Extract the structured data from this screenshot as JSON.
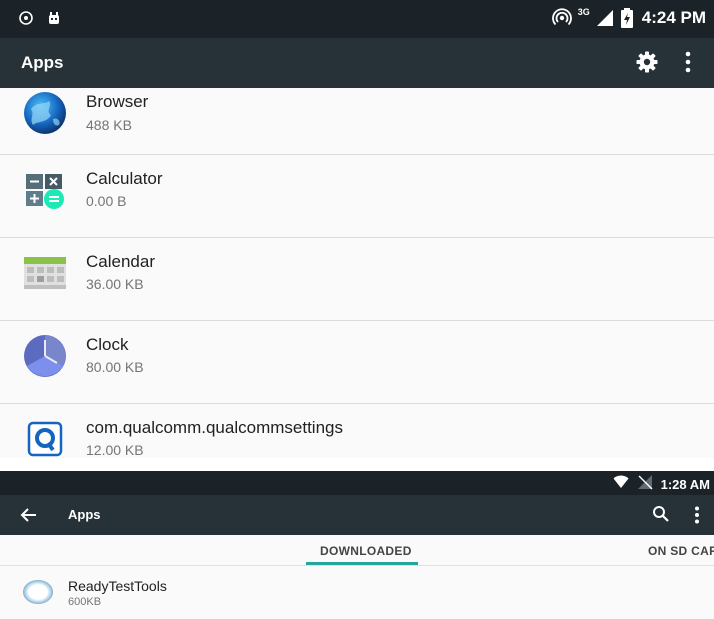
{
  "screen1": {
    "status": {
      "time": "4:24 PM",
      "network": "3G"
    },
    "title": "Apps",
    "icons": {
      "settings": "gear-icon",
      "overflow": "more-vert-icon"
    },
    "apps": [
      {
        "name": "Browser",
        "size": "488 KB",
        "icon": "browser-globe-icon"
      },
      {
        "name": "Calculator",
        "size": "0.00 B",
        "icon": "calculator-icon"
      },
      {
        "name": "Calendar",
        "size": "36.00 KB",
        "icon": "calendar-icon"
      },
      {
        "name": "Clock",
        "size": "80.00 KB",
        "icon": "clock-icon"
      },
      {
        "name": "com.qualcomm.qualcommsettings",
        "size": "12.00 KB",
        "icon": "qualcomm-icon"
      }
    ]
  },
  "screen2": {
    "status": {
      "time": "1:28 AM"
    },
    "title": "Apps",
    "icons": {
      "back": "back-arrow-icon",
      "search": "search-icon",
      "overflow": "more-vert-icon"
    },
    "tabs": [
      {
        "label": "DOWNLOADED",
        "selected": true
      },
      {
        "label": "ON SD CARD",
        "selected": false
      }
    ],
    "apps": [
      {
        "name": "ReadyTestTools",
        "size": "600KB",
        "icon": "app-ring-icon"
      }
    ],
    "colors": {
      "accent": "#26a69a"
    }
  },
  "colors": {
    "statusbar": "#1b2328",
    "appbar": "#263238",
    "background": "#fafafa"
  }
}
